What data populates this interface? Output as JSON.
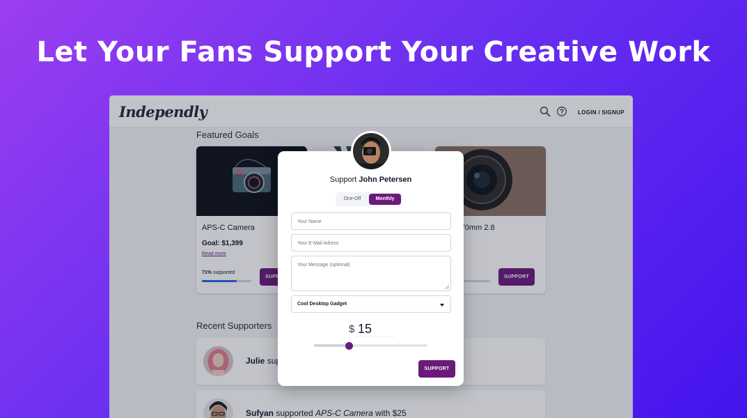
{
  "hero": {
    "title": "Let Your Fans Support Your Creative Work"
  },
  "navbar": {
    "logo": "Independly",
    "login": "LOGIN / SIGNUP",
    "icons": [
      "search-icon",
      "help-icon"
    ]
  },
  "featured": {
    "title": "Featured Goals",
    "cards": [
      {
        "title": "APS-C Camera",
        "goal": "Goal: $1,399",
        "read_more": "Read more",
        "pct_value": "71%",
        "pct_label": "supported",
        "progress": 0.71,
        "button": "SUPPORT"
      },
      {
        "title": "",
        "goal": "",
        "read_more": "",
        "pct_value": "",
        "pct_label": "",
        "progress": 0,
        "button": "SUPPORT"
      },
      {
        "title": "ens 17-70mm 2.8",
        "goal": "349",
        "read_more": "e",
        "pct_value": "",
        "pct_label": "pported",
        "progress": 0.48,
        "button": "SUPPORT"
      }
    ]
  },
  "supporters": {
    "title": "Recent Supporters",
    "items": [
      {
        "name": "Julie",
        "action": " sup",
        "item": "",
        "tail": ""
      },
      {
        "name": "Sufyan",
        "action": " supported ",
        "item": "APS-C Camera",
        "tail": " with $25"
      }
    ]
  },
  "modal": {
    "support_prefix": "Support ",
    "creator": "John Petersen",
    "toggle": {
      "one_off": "One-Off",
      "monthly": "Monthly",
      "selected": "Monthly"
    },
    "name_placeholder": "Your Name",
    "email_placeholder": "Your E-Mail Adress",
    "message_placeholder": "Your Message (optional)",
    "select_value": "Cool Desktop Gadget",
    "currency": "$",
    "amount": "15",
    "slider_level": 0.31,
    "button": "SUPPORT"
  },
  "colors": {
    "accent": "#6b1a7a",
    "progress": "#2563eb"
  }
}
